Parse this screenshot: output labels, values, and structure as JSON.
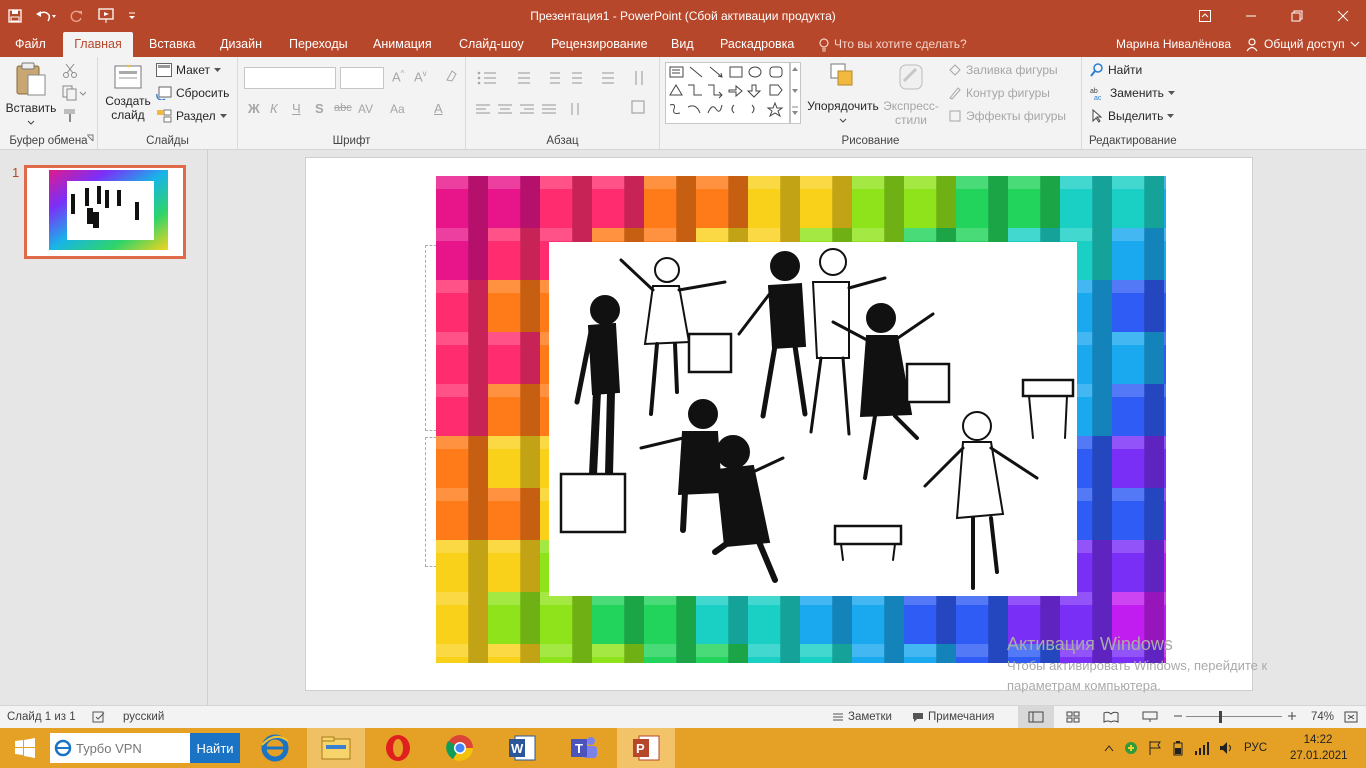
{
  "window": {
    "title": "Презентация1 - PowerPoint (Сбой активации продукта)"
  },
  "tabs": [
    {
      "label": "Файл"
    },
    {
      "label": "Главная"
    },
    {
      "label": "Вставка"
    },
    {
      "label": "Дизайн"
    },
    {
      "label": "Переходы"
    },
    {
      "label": "Анимация"
    },
    {
      "label": "Слайд-шоу"
    },
    {
      "label": "Рецензирование"
    },
    {
      "label": "Вид"
    },
    {
      "label": "Раскадровка"
    }
  ],
  "tell_me": "Что вы хотите сделать?",
  "user_name": "Марина Нивалёнова",
  "share_label": "Общий доступ",
  "ribbon": {
    "clipboard": {
      "paste": "Вставить",
      "title": "Буфер обмена"
    },
    "slides": {
      "new_slide_1": "Создать",
      "new_slide_2": "слайд",
      "layout": "Макет",
      "reset": "Сбросить",
      "section": "Раздел",
      "title": "Слайды"
    },
    "font": {
      "bold": "Ж",
      "italic": "К",
      "underline": "Ч",
      "shadow": "S",
      "strike": "abc",
      "spacing": "AV",
      "case": "Aa",
      "color": "A",
      "title": "Шрифт"
    },
    "paragraph": {
      "title": "Абзац"
    },
    "drawing": {
      "arrange": "Упорядочить",
      "styles_1": "Экспресс-",
      "styles_2": "стили",
      "fill": "Заливка фигуры",
      "outline": "Контур фигуры",
      "effects": "Эффекты фигуры",
      "title": "Рисование"
    },
    "editing": {
      "find": "Найти",
      "replace": "Заменить",
      "select": "Выделить",
      "title": "Редактирование"
    }
  },
  "thumbnail_number": "1",
  "watermark": {
    "title": "Активация Windows",
    "line1": "Чтобы активировать Windows, перейдите к",
    "line2": "параметрам компьютера."
  },
  "status": {
    "slide_info": "Слайд 1 из 1",
    "language": "русский",
    "notes": "Заметки",
    "comments": "Примечания",
    "zoom": "74%"
  },
  "taskbar": {
    "search_placeholder": "Турбо VPN",
    "search_button": "Найти",
    "language": "РУС",
    "time": "14:22",
    "date": "27.01.2021"
  },
  "colors": {
    "accent": "#b7472a",
    "taskbar": "#e5a125"
  }
}
